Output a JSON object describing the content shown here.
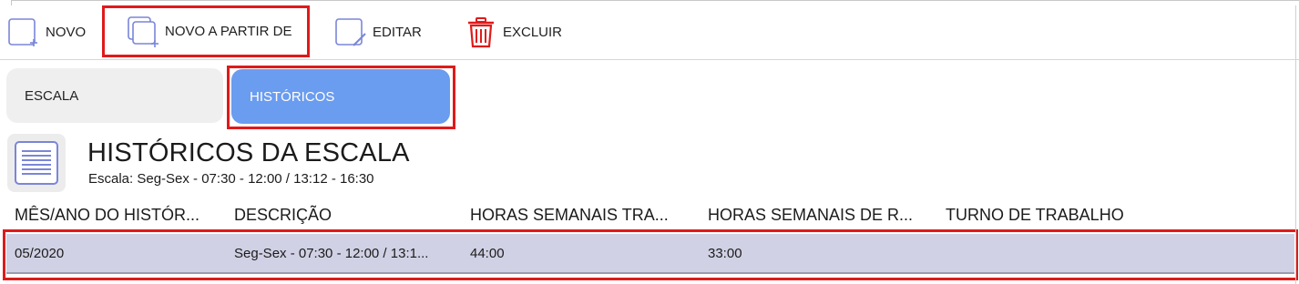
{
  "toolbar": {
    "novo_label": "NOVO",
    "novo_partir_label": "NOVO A PARTIR DE",
    "editar_label": "EDITAR",
    "excluir_label": "EXCLUIR"
  },
  "tabs": [
    {
      "label": "ESCALA",
      "active": false
    },
    {
      "label": "HISTÓRICOS",
      "active": true
    }
  ],
  "header": {
    "title": "HISTÓRICOS DA ESCALA",
    "subtitle": "Escala: Seg-Sex - 07:30 - 12:00 / 13:12 - 16:30"
  },
  "table": {
    "columns": [
      "MÊS/ANO DO HISTÓR...",
      "DESCRIÇÃO",
      "HORAS SEMANAIS TRA...",
      "HORAS SEMANAIS DE R...",
      "TURNO DE TRABALHO"
    ],
    "rows": [
      {
        "mes_ano": "05/2020",
        "descricao": "Seg-Sex - 07:30 - 12:00 / 13:1...",
        "horas_trabalho": "44:00",
        "horas_r": "33:00",
        "turno": ""
      }
    ]
  },
  "colors": {
    "highlight": "#e01a1a",
    "active_tab": "#6a9cf0",
    "selected_row": "#d1d1e5",
    "icon_blue": "#7a86d8",
    "delete_red": "#e01a1a"
  },
  "icons": {
    "novo": "add-document-icon",
    "novo_partir": "copy-add-icon",
    "editar": "edit-document-icon",
    "excluir": "trash-icon",
    "header": "list-document-icon"
  }
}
